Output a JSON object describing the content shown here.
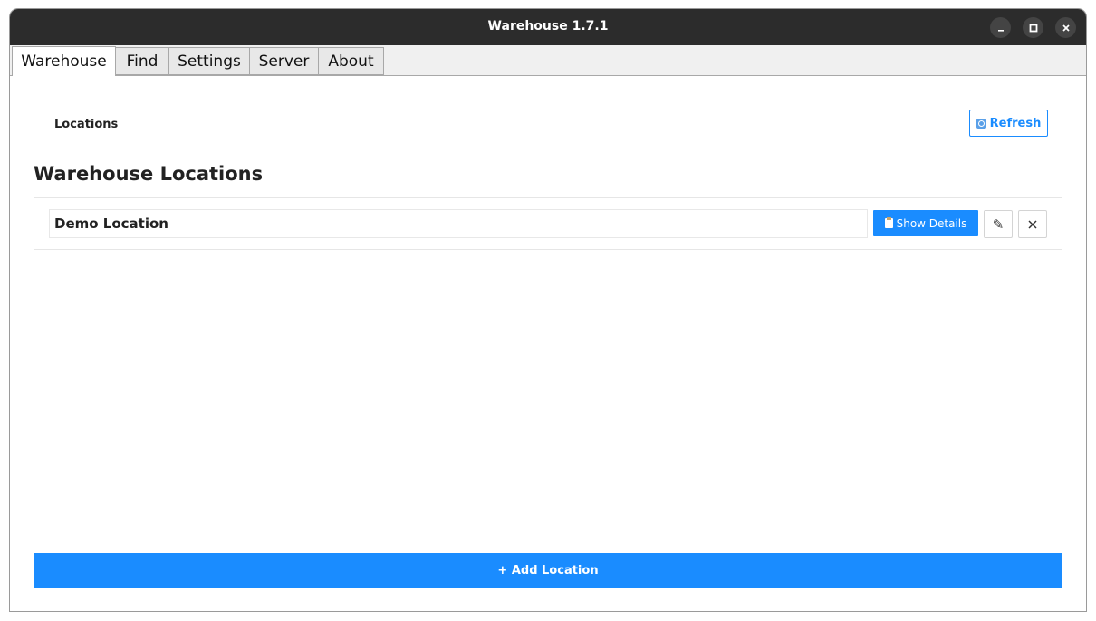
{
  "window": {
    "title": "Warehouse 1.7.1",
    "controls": {
      "minimize_icon": "minimize-icon",
      "maximize_icon": "maximize-icon",
      "close_icon": "close-icon"
    }
  },
  "tabs": [
    {
      "label": "Warehouse",
      "active": true
    },
    {
      "label": "Find",
      "active": false
    },
    {
      "label": "Settings",
      "active": false
    },
    {
      "label": "Server",
      "active": false
    },
    {
      "label": "About",
      "active": false
    }
  ],
  "header": {
    "breadcrumb": "Locations",
    "refresh_label": "Refresh",
    "refresh_icon": "refresh-icon"
  },
  "main": {
    "heading": "Warehouse Locations",
    "locations": [
      {
        "name": "Demo Location",
        "show_details_label": "Show Details",
        "show_details_icon": "clipboard-icon",
        "edit_icon": "pencil-icon",
        "delete_icon": "close-icon"
      }
    ],
    "add_label": "+ Add Location"
  },
  "colors": {
    "accent": "#1a8cff",
    "titlebar": "#2c2c2c",
    "tabbar": "#f0f0f0"
  }
}
